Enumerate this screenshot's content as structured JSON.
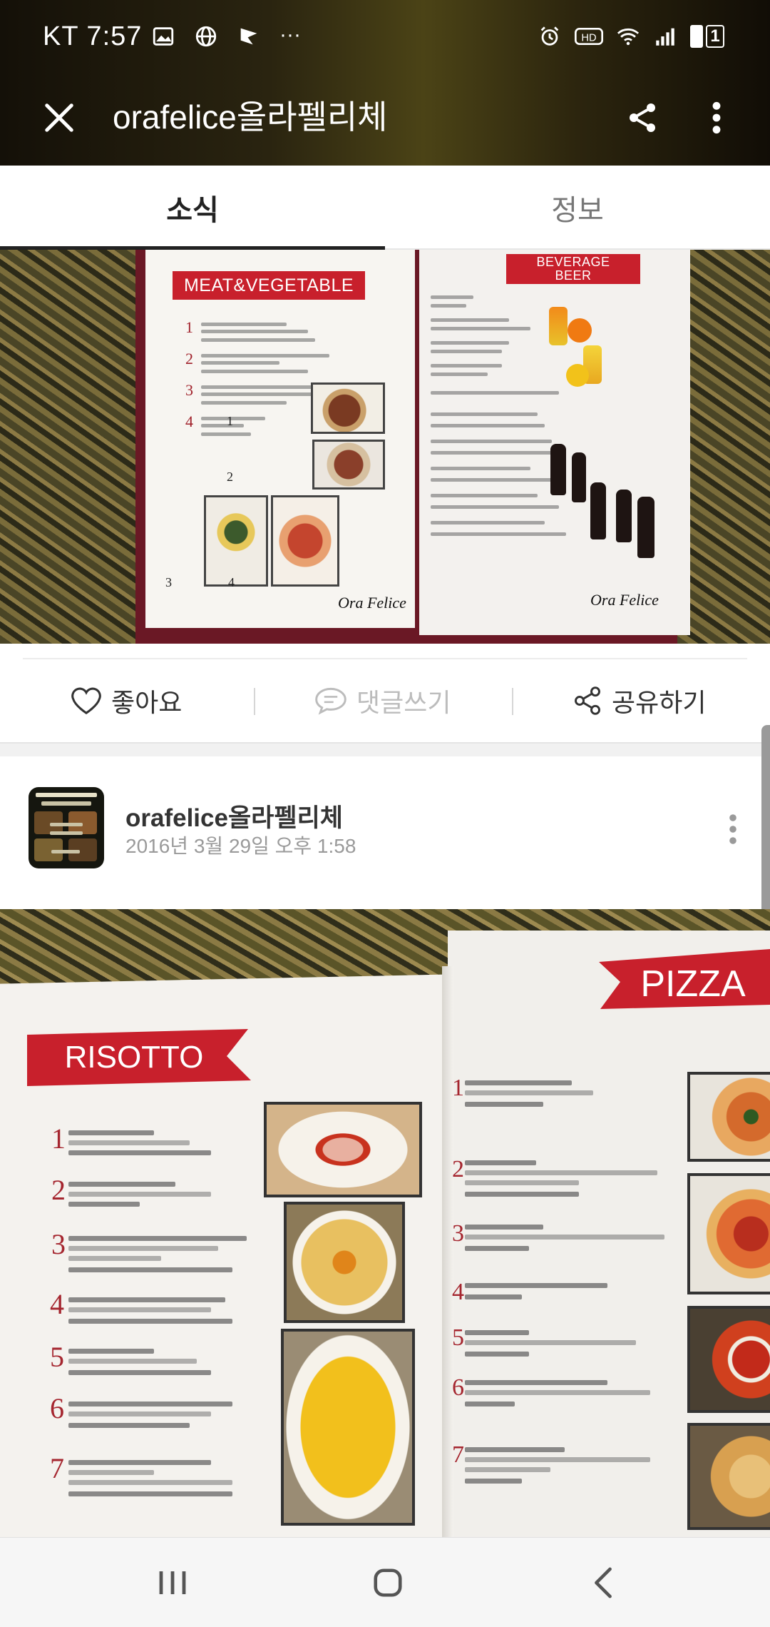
{
  "status_bar": {
    "time": "KT 7:57",
    "left_icons": [
      "gallery-icon",
      "globe-icon",
      "flag-icon",
      "more-dots-icon"
    ],
    "more": "···",
    "right_icons": [
      "alarm-icon",
      "hd-icon",
      "wifi-icon",
      "signal-icon",
      "battery-icon"
    ],
    "battery_level": "1"
  },
  "app_bar": {
    "title": "orafelice올라펠리체"
  },
  "tabs": [
    {
      "label": "소식",
      "selected": true
    },
    {
      "label": "정보",
      "selected": false
    }
  ],
  "post1": {
    "image_text": {
      "left_banner": "MEAT&VEGETABLE",
      "right_banner_1": "BEVERAGE",
      "right_banner_2": "BEER",
      "signature": "Ora Felice",
      "photo_numbers": [
        "1",
        "2",
        "3",
        "4"
      ]
    },
    "actions": {
      "like": "좋아요",
      "comment": "댓글쓰기",
      "share": "공유하기"
    }
  },
  "post2": {
    "author": "orafelice올라펠리체",
    "date": "2016년 3월 29일 오후 1:58",
    "image_text": {
      "left_banner": "RISOTTO",
      "right_banner": "PIZZA",
      "numbers": [
        "1",
        "2",
        "3",
        "4",
        "5",
        "6",
        "7"
      ]
    }
  },
  "colors": {
    "banner_red": "#c8202c",
    "menu_cover": "#6a1825",
    "tab_indicator": "#222222",
    "muted_text": "#9a9a9a"
  },
  "nav_bar": {
    "buttons": [
      "recent-apps-icon",
      "home-icon",
      "back-icon"
    ]
  }
}
